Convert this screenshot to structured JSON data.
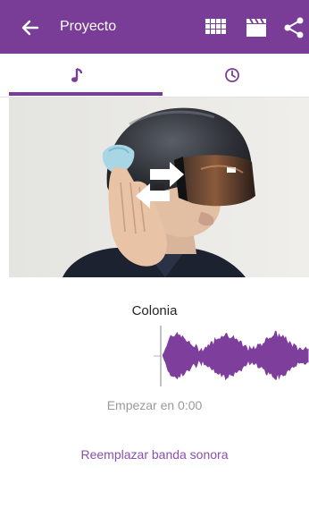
{
  "app_bar": {
    "title": "Proyecto",
    "background_color": "#7a3d97",
    "icons": [
      "back-arrow-icon",
      "grid-icon",
      "clapperboard-icon",
      "share-icon"
    ]
  },
  "tabs": [
    {
      "icon": "music-note-icon",
      "selected": true
    },
    {
      "icon": "clock-icon",
      "selected": false
    }
  ],
  "main": {
    "song_title": "Colonia",
    "start_label": "Empezar en 0:00",
    "replace_label": "Reemplazar banda sonora",
    "accent_color": "#8a4fb0"
  }
}
